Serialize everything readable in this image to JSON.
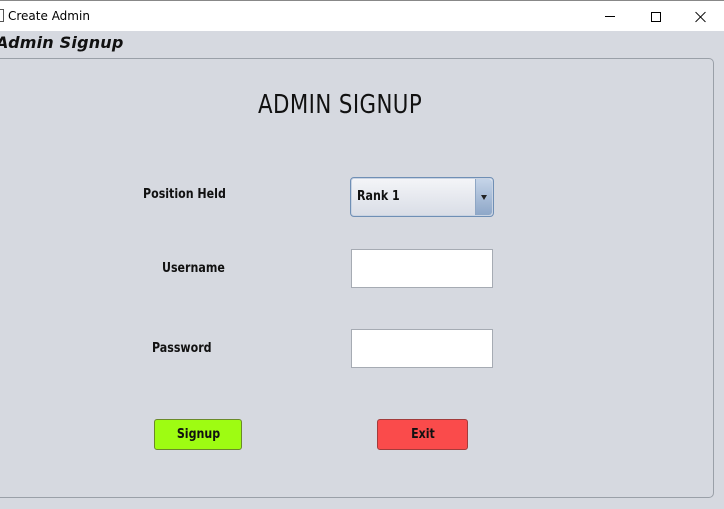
{
  "window": {
    "title": "Create Admin",
    "controls": {
      "minimize": "minimize-icon",
      "maximize": "maximize-icon",
      "close": "close-icon"
    }
  },
  "frame": {
    "title": "Admin Signup"
  },
  "form": {
    "heading": "ADMIN SIGNUP",
    "position": {
      "label": "Position Held",
      "selected": "Rank 1"
    },
    "username": {
      "label": "Username",
      "value": ""
    },
    "password": {
      "label": "Password",
      "value": ""
    }
  },
  "buttons": {
    "signup": {
      "label": "Signup",
      "color": "#9efc12"
    },
    "exit": {
      "label": "Exit",
      "color": "#fa4b4b"
    }
  }
}
